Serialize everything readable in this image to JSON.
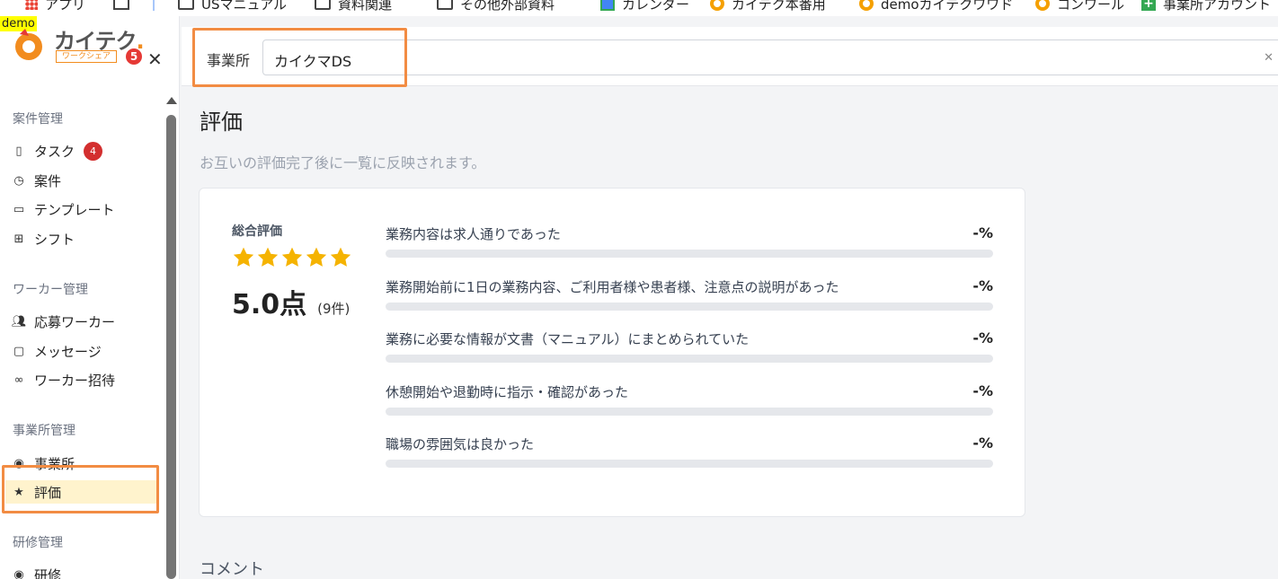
{
  "bookmarks": [
    {
      "label": "アプリ",
      "icon": "apps-icon"
    },
    {
      "label": "",
      "icon": "tab-grid-icon"
    },
    {
      "label": "USマニュアル",
      "icon": "folder-icon"
    },
    {
      "label": "資料関連",
      "icon": "folder-icon"
    },
    {
      "label": "その他外部資料",
      "icon": "folder-icon"
    },
    {
      "label": "カレンダー",
      "icon": "calendar-icon"
    },
    {
      "label": "カイテク本番用",
      "icon": "kaiteku-icon"
    },
    {
      "label": "demoカイテクワワド",
      "icon": "kaiteku-icon"
    },
    {
      "label": "コンワール",
      "icon": "kaiteku-icon"
    },
    {
      "label": "事業所アカウント",
      "icon": "plus-icon"
    }
  ],
  "sidebar": {
    "demo_tag": "demo",
    "logo": {
      "brand": "カイテク",
      "sub": "ワークシェア",
      "badge": "5"
    },
    "sections": [
      {
        "title": "案件管理"
      },
      {
        "title": "ワーカー管理"
      },
      {
        "title": "事業所管理"
      },
      {
        "title": "研修管理"
      }
    ],
    "items": {
      "task": {
        "label": "タスク",
        "badge": "4"
      },
      "case": {
        "label": "案件"
      },
      "template": {
        "label": "テンプレート"
      },
      "shift": {
        "label": "シフト"
      },
      "applicants": {
        "label": "応募ワーカー"
      },
      "messages": {
        "label": "メッセージ"
      },
      "invite": {
        "label": "ワーカー招待"
      },
      "office": {
        "label": "事業所"
      },
      "rating": {
        "label": "評価"
      },
      "training": {
        "label": "研修"
      }
    }
  },
  "filter": {
    "label": "事業所",
    "value": "カイクマDS"
  },
  "page": {
    "title": "評価",
    "subtitle": "お互いの評価完了後に一覧に反映されます。",
    "comments_title": "コメント"
  },
  "rating": {
    "overall_label": "総合評価",
    "stars": 5,
    "score": "5.0点",
    "count": "(9件)",
    "criteria": [
      {
        "text": "業務内容は求人通りであった",
        "value": "-%",
        "fill": 0
      },
      {
        "text": "業務開始前に1日の業務内容、ご利用者様や患者様、注意点の説明があった",
        "value": "-%",
        "fill": 0
      },
      {
        "text": "業務に必要な情報が文書（マニュアル）にまとめられていた",
        "value": "-%",
        "fill": 0
      },
      {
        "text": "休憩開始や退勤時に指示・確認があった",
        "value": "-%",
        "fill": 0
      },
      {
        "text": "職場の雰囲気は良かった",
        "value": "-%",
        "fill": 0
      }
    ]
  },
  "colors": {
    "accent": "#f28c1e",
    "highlight": "#f28c43",
    "star": "#f5b300",
    "active_bg": "#fff3cd"
  }
}
